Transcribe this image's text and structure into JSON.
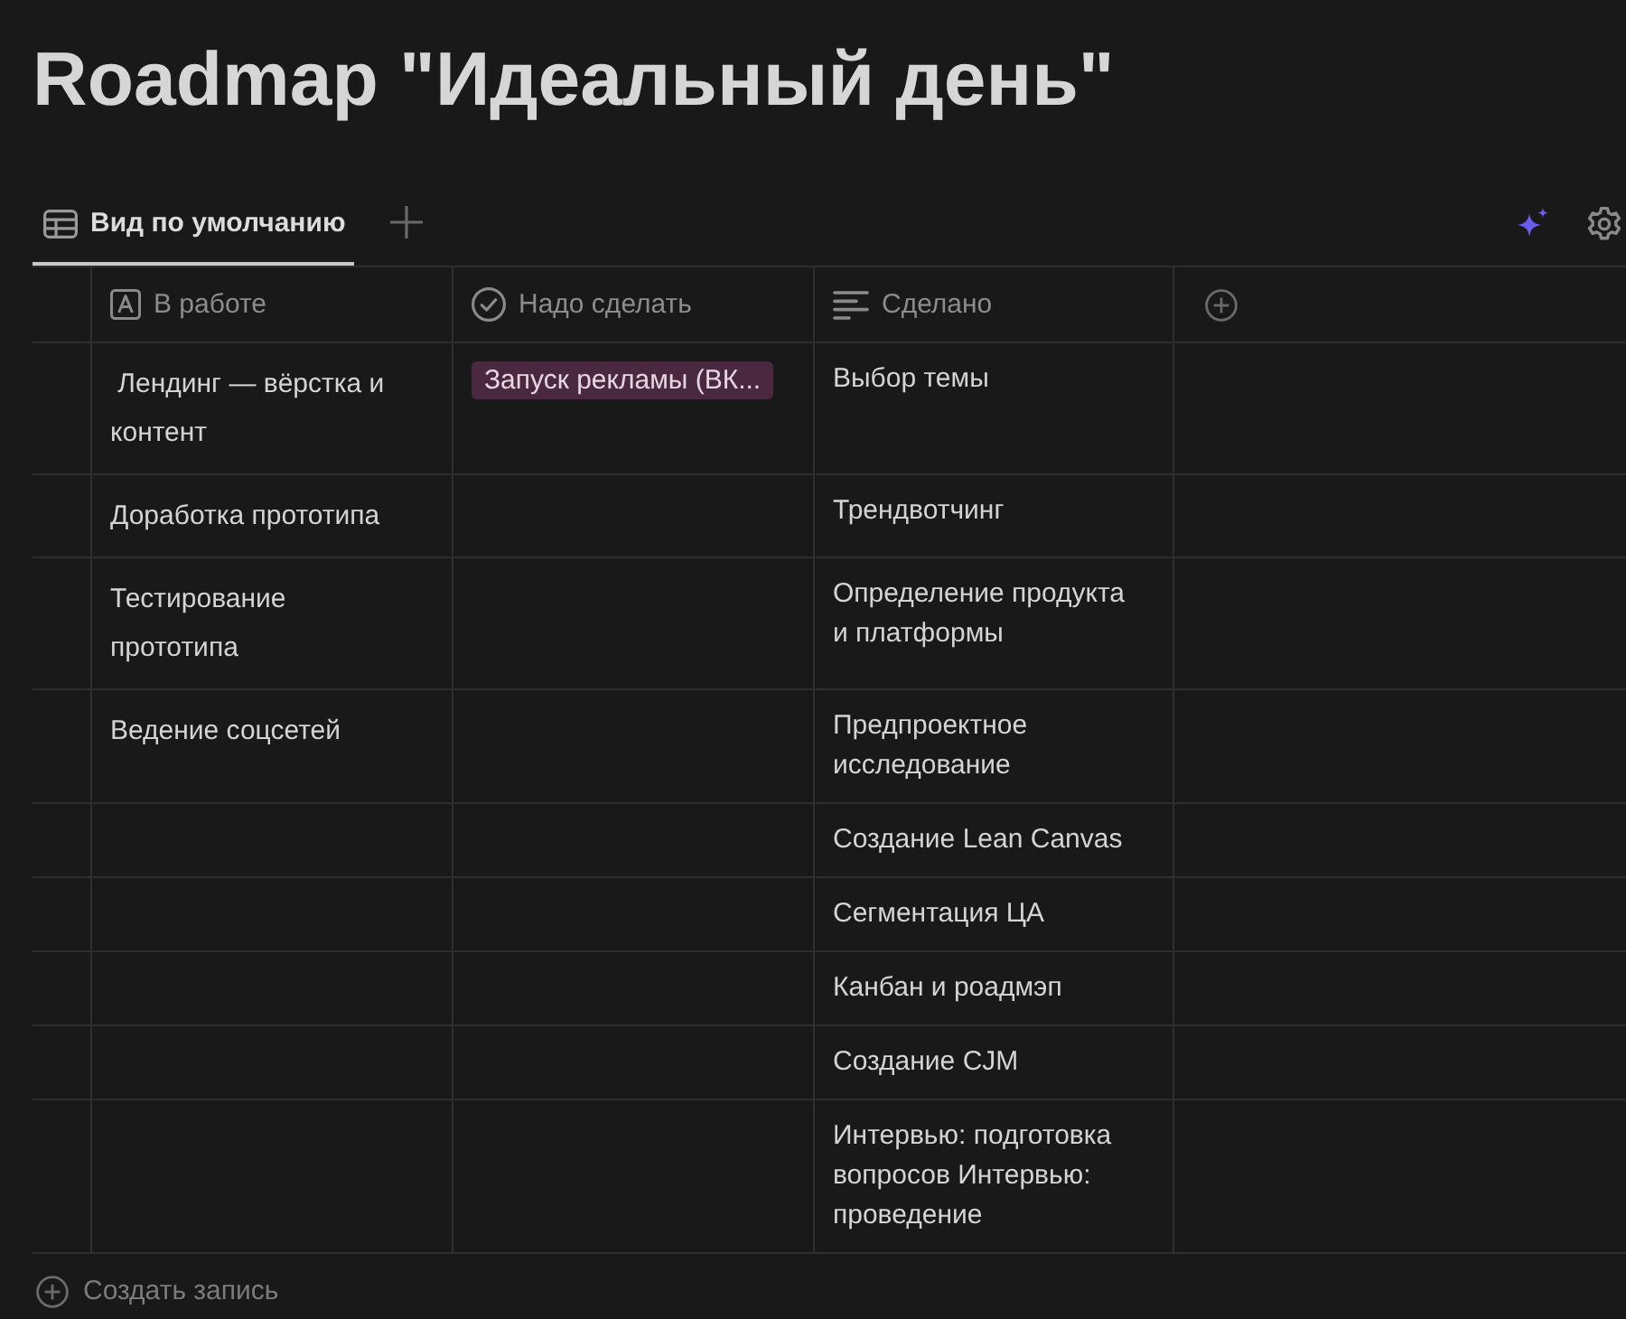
{
  "page": {
    "title": "Roadmap \"Идеальный день\""
  },
  "tabs": [
    {
      "label": "Вид по умолчанию",
      "selected": true
    }
  ],
  "table": {
    "columns": [
      {
        "label": "В работе",
        "kind": "title"
      },
      {
        "label": "Надо сделать",
        "kind": "status"
      },
      {
        "label": "Сделано",
        "kind": "text"
      }
    ],
    "rows": [
      {
        "cells": [
          {
            "text": " Лендинг — вёрстка и контент"
          },
          {
            "tags": [
              {
                "label": "Запуск рекламы (ВК...",
                "color": "#4a2840"
              }
            ]
          },
          {
            "text": "Выбор темы"
          }
        ]
      },
      {
        "cells": [
          {
            "text": "Доработка прототипа"
          },
          null,
          {
            "text": "Трендвотчинг"
          }
        ]
      },
      {
        "cells": [
          {
            "text": "Тестирование прототипа"
          },
          null,
          {
            "text": "Определение продукта и платформы"
          }
        ]
      },
      {
        "cells": [
          {
            "text": "Ведение соцсетей"
          },
          null,
          {
            "text": "Предпроектное исследование"
          }
        ]
      },
      {
        "cells": [
          null,
          null,
          {
            "text": "Создание Lean Canvas"
          }
        ]
      },
      {
        "cells": [
          null,
          null,
          {
            "text": "Сегментация ЦА"
          }
        ]
      },
      {
        "cells": [
          null,
          null,
          {
            "text": "Канбан и роадмэп"
          }
        ]
      },
      {
        "cells": [
          null,
          null,
          {
            "text": "Создание CJM"
          }
        ]
      },
      {
        "cells": [
          null,
          null,
          {
            "text": "Интервью: подготовка вопросов Интервью: проведение"
          }
        ]
      }
    ]
  },
  "footer": {
    "new_record": "Создать запись"
  }
}
